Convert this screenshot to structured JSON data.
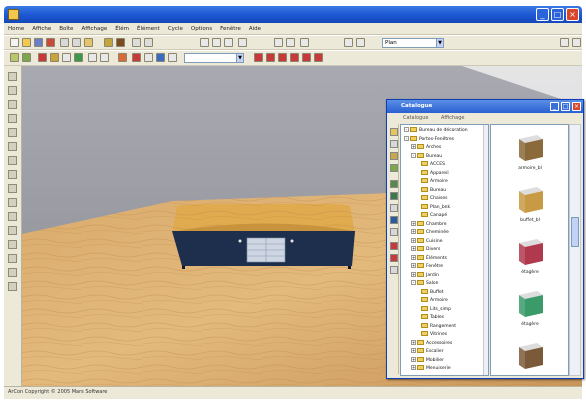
{
  "app": {
    "menus": [
      "Home",
      "Affiche",
      "Boîte",
      "Affichage",
      "Élém",
      "Élément",
      "Cycle",
      "Options",
      "Fenêtre",
      "Aide"
    ]
  },
  "toolbar": {
    "view_select": "Plan",
    "style_select": ""
  },
  "catalog": {
    "title": "Catalogue",
    "tabs": [
      "Catalogue",
      "Affichage"
    ],
    "tree": [
      {
        "label": "Bureau de décoration",
        "level": 0,
        "expander": "-"
      },
      {
        "label": "Portes-Fenêtres",
        "level": 0,
        "expander": "-"
      },
      {
        "label": "Arches",
        "level": 1,
        "expander": "+"
      },
      {
        "label": "Bureau",
        "level": 1,
        "expander": "-"
      },
      {
        "label": "ACCES",
        "level": 2,
        "expander": ""
      },
      {
        "label": "Appareil",
        "level": 2,
        "expander": ""
      },
      {
        "label": "Armoire",
        "level": 2,
        "expander": ""
      },
      {
        "label": "Bureau",
        "level": 2,
        "expander": ""
      },
      {
        "label": "Chaises",
        "level": 2,
        "expander": ""
      },
      {
        "label": "Plan_bnk",
        "level": 2,
        "expander": ""
      },
      {
        "label": "Canapé",
        "level": 2,
        "expander": ""
      },
      {
        "label": "Chambre",
        "level": 1,
        "expander": "+"
      },
      {
        "label": "Cheminée",
        "level": 1,
        "expander": "+"
      },
      {
        "label": "Cuisine",
        "level": 1,
        "expander": "+"
      },
      {
        "label": "Divers",
        "level": 1,
        "expander": "+"
      },
      {
        "label": "Éléments",
        "level": 1,
        "expander": "+"
      },
      {
        "label": "Fenêtre",
        "level": 1,
        "expander": "+"
      },
      {
        "label": "Jardin",
        "level": 1,
        "expander": "+"
      },
      {
        "label": "Salon",
        "level": 1,
        "expander": "-"
      },
      {
        "label": "Buffet",
        "level": 2,
        "expander": ""
      },
      {
        "label": "Armoire",
        "level": 2,
        "expander": ""
      },
      {
        "label": "Lits_simp",
        "level": 2,
        "expander": ""
      },
      {
        "label": "Tables",
        "level": 2,
        "expander": ""
      },
      {
        "label": "Rangement",
        "level": 2,
        "expander": ""
      },
      {
        "label": "Vitrines",
        "level": 2,
        "expander": ""
      },
      {
        "label": "Accessoires",
        "level": 1,
        "expander": "+"
      },
      {
        "label": "Escalier",
        "level": 1,
        "expander": "+"
      },
      {
        "label": "Mobilier",
        "level": 1,
        "expander": "+"
      },
      {
        "label": "Menuiserie",
        "level": 1,
        "expander": "+"
      }
    ],
    "items": [
      {
        "caption": "armoire_bl",
        "color": "#8a6a3a"
      },
      {
        "caption": "buffet_bl",
        "color": "#c89a45"
      },
      {
        "caption": "étagère",
        "color": "#b0394e"
      },
      {
        "caption": "étagère",
        "color": "#3a9a6a"
      },
      {
        "caption": "",
        "color": "#7b5a3a"
      }
    ]
  },
  "statusbar": {
    "text": "ArCon Copyright © 2005 Mars Software"
  },
  "colors": {
    "titlebar": "#1c56d1",
    "chrome": "#ece9d8",
    "floor": "#d8a96a",
    "wall": "#8f8f9a",
    "cabinet_top": "#e0aa4e",
    "cabinet_front": "#1e2f4e"
  }
}
